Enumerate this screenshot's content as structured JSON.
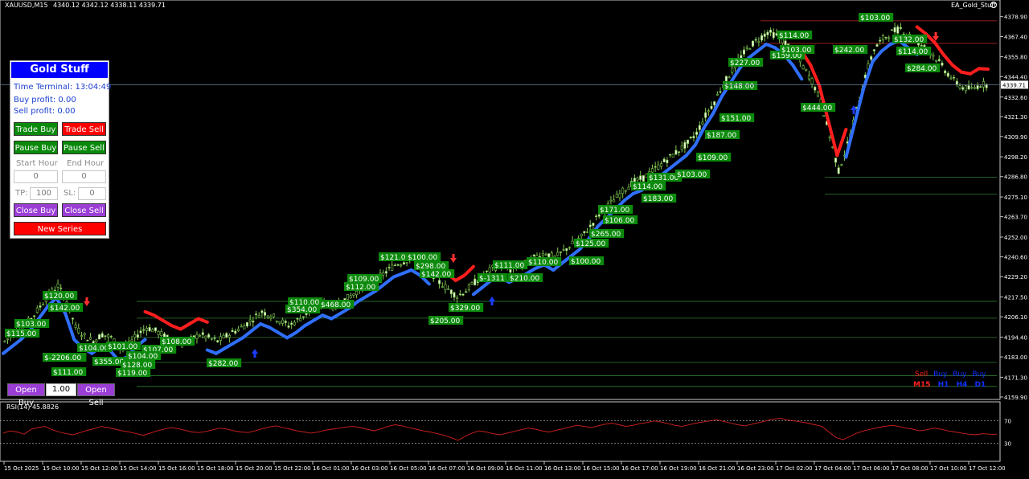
{
  "header": {
    "symbol": "XAUUSD,M15",
    "ohlc": "4340.12 4342.12 4338.11 4339.71",
    "ea_name": "EA_Gold_Stuff"
  },
  "panel": {
    "title": "Gold Stuff",
    "time_terminal": "Time Terminal: 13:04:49",
    "buy_profit": "Buy profit: 0.00",
    "sell_profit": "Sell profit: 0.00",
    "trade_buy": "Trade Buy",
    "trade_sell": "Trade Sell",
    "pause_buy": "Pause Buy",
    "pause_sell": "Pause Sell",
    "start_hour_label": "Start Hour",
    "end_hour_label": "End Hour",
    "start_hour_value": "0",
    "end_hour_value": "0",
    "tp_label": "TP:",
    "tp_value": "100",
    "sl_label": "SL:",
    "sl_value": "0",
    "close_buy": "Close Buy",
    "close_sell": "Close Sell",
    "new_series": "New Series"
  },
  "bottom": {
    "open_buy": "Open Buy",
    "lot": "1.00",
    "open_sell": "Open Sell"
  },
  "legend": {
    "row1": [
      "Sell",
      "Buy",
      "Buy",
      "Buy"
    ],
    "row2": [
      "M15",
      "H1",
      "H4",
      "D1"
    ]
  },
  "price_axis": {
    "ticks": [
      "4378.90",
      "4367.40",
      "4355.80",
      "4344.40",
      "4332.60",
      "4321.30",
      "4309.90",
      "4298.20",
      "4286.80",
      "4275.10",
      "4263.70",
      "4252.00",
      "4240.60",
      "4229.20",
      "4217.50",
      "4206.10",
      "4194.40",
      "4183.00",
      "4171.30",
      "4159.90"
    ],
    "current": "4339.71"
  },
  "time_axis": {
    "ticks": [
      "15 Oct 2025",
      "15 Oct 10:00",
      "15 Oct 12:00",
      "15 Oct 14:00",
      "15 Oct 16:00",
      "15 Oct 18:00",
      "15 Oct 20:00",
      "15 Oct 22:00",
      "16 Oct 01:00",
      "16 Oct 03:00",
      "16 Oct 05:00",
      "16 Oct 07:00",
      "16 Oct 09:00",
      "16 Oct 11:00",
      "16 Oct 13:00",
      "16 Oct 15:00",
      "16 Oct 17:00",
      "16 Oct 19:00",
      "16 Oct 21:00",
      "16 Oct 23:00",
      "17 Oct 02:00",
      "17 Oct 04:00",
      "17 Oct 06:00",
      "17 Oct 08:00",
      "17 Oct 10:00",
      "17 Oct 12:00"
    ]
  },
  "rsi": {
    "label": "RSI(14) 45.8826",
    "levels": [
      "100",
      "70",
      "30",
      "0"
    ],
    "values": [
      48,
      52,
      50,
      46,
      55,
      58,
      60,
      54,
      50,
      47,
      45,
      49,
      53,
      56,
      60,
      58,
      55,
      52,
      50,
      47,
      44,
      48,
      52,
      55,
      58,
      56,
      53,
      50,
      49,
      51,
      54,
      57,
      55,
      52,
      50,
      49,
      52,
      56,
      59,
      61,
      58,
      55,
      52,
      50,
      48,
      50,
      53,
      55,
      57,
      59,
      60,
      58,
      55,
      52,
      56,
      60,
      63,
      61,
      58,
      55,
      52,
      50,
      47,
      44,
      40,
      35,
      42,
      48,
      52,
      50,
      47,
      45,
      48,
      51,
      54,
      57,
      55,
      52,
      50,
      53,
      56,
      59,
      62,
      60,
      58,
      61,
      64,
      66,
      63,
      60,
      62,
      65,
      67,
      70,
      68,
      65,
      62,
      60,
      63,
      66,
      68,
      70,
      72,
      69,
      66,
      63,
      61,
      64,
      67,
      70,
      73,
      75,
      72,
      70,
      68,
      66,
      63,
      60,
      50,
      40,
      36,
      42,
      48,
      52,
      55,
      58,
      60,
      62,
      60,
      57,
      55,
      52,
      54,
      57,
      55,
      52,
      50,
      48,
      46,
      45,
      47,
      46,
      45.9
    ]
  },
  "chart_data": {
    "type": "candlestick",
    "y_range": [
      4159.9,
      4382.0
    ],
    "current_price": 4339.71,
    "price_path": [
      4192,
      4196,
      4200,
      4205,
      4212,
      4219,
      4224,
      4215,
      4200,
      4195,
      4192,
      4196,
      4194,
      4188,
      4190,
      4196,
      4200,
      4198,
      4195,
      4192,
      4190,
      4193,
      4196,
      4194,
      4192,
      4195,
      4198,
      4201,
      4205,
      4209,
      4207,
      4204,
      4201,
      4204,
      4208,
      4211,
      4214,
      4212,
      4215,
      4218,
      4222,
      4225,
      4228,
      4232,
      4236,
      4238,
      4240,
      4237,
      4232,
      4226,
      4222,
      4218,
      4221,
      4226,
      4230,
      4234,
      4236,
      4233,
      4235,
      4238,
      4241,
      4243,
      4240,
      4244,
      4248,
      4252,
      4258,
      4265,
      4270,
      4275,
      4280,
      4284,
      4286,
      4290,
      4294,
      4298,
      4302,
      4306,
      4312,
      4322,
      4330,
      4340,
      4348,
      4356,
      4362,
      4366,
      4370,
      4368,
      4364,
      4358,
      4350,
      4342,
      4330,
      4310,
      4290,
      4305,
      4325,
      4345,
      4360,
      4366,
      4370,
      4372,
      4368,
      4364,
      4360,
      4355,
      4348,
      4342,
      4338,
      4337,
      4340,
      4339.7
    ],
    "supertrend_buy_color": "#2f6fff",
    "supertrend_sell_color": "#ff1e1e",
    "profit_labels": [
      {
        "t": "$115.00",
        "x": 6,
        "y": 409
      },
      {
        "t": "$103.00",
        "x": 18,
        "y": 397
      },
      {
        "t": "$142.00",
        "x": 60,
        "y": 377
      },
      {
        "t": "$120.00",
        "x": 53,
        "y": 362
      },
      {
        "t": "$-2206.00",
        "x": 53,
        "y": 439
      },
      {
        "t": "$111.00",
        "x": 64,
        "y": 457
      },
      {
        "t": "$104.00",
        "x": 96,
        "y": 427
      },
      {
        "t": "$355.00",
        "x": 115,
        "y": 444
      },
      {
        "t": "$101.00",
        "x": 132,
        "y": 425
      },
      {
        "t": "$107.00",
        "x": 176,
        "y": 429
      },
      {
        "t": "$104.00",
        "x": 157,
        "y": 437
      },
      {
        "t": "$128.00",
        "x": 150,
        "y": 448
      },
      {
        "t": "$119.00",
        "x": 144,
        "y": 458
      },
      {
        "t": "$108.00",
        "x": 199,
        "y": 419
      },
      {
        "t": "$282.00",
        "x": 257,
        "y": 446
      },
      {
        "t": "$110.00",
        "x": 358,
        "y": 370
      },
      {
        "t": "$354.00",
        "x": 355,
        "y": 379
      },
      {
        "t": "$468.00",
        "x": 397,
        "y": 373
      },
      {
        "t": "$109.00",
        "x": 432,
        "y": 341
      },
      {
        "t": "$112.00",
        "x": 428,
        "y": 351
      },
      {
        "t": "$121.00",
        "x": 471,
        "y": 314
      },
      {
        "t": "$100.00",
        "x": 505,
        "y": 314
      },
      {
        "t": "$298.00",
        "x": 515,
        "y": 325
      },
      {
        "t": "$142.00",
        "x": 522,
        "y": 335
      },
      {
        "t": "$329.00",
        "x": 558,
        "y": 377
      },
      {
        "t": "$205.00",
        "x": 533,
        "y": 393
      },
      {
        "t": "$-1311",
        "x": 594,
        "y": 340
      },
      {
        "t": "$210.00",
        "x": 632,
        "y": 340
      },
      {
        "t": "$111.00",
        "x": 613,
        "y": 324
      },
      {
        "t": "$110.00",
        "x": 655,
        "y": 320
      },
      {
        "t": "$100.00",
        "x": 708,
        "y": 319
      },
      {
        "t": "$125.00",
        "x": 714,
        "y": 297
      },
      {
        "t": "$265.00",
        "x": 733,
        "y": 285
      },
      {
        "t": "$106.00",
        "x": 750,
        "y": 268
      },
      {
        "t": "$171.00",
        "x": 744,
        "y": 255
      },
      {
        "t": "$183.00",
        "x": 798,
        "y": 241
      },
      {
        "t": "$114.00",
        "x": 785,
        "y": 226
      },
      {
        "t": "$131.00",
        "x": 805,
        "y": 215
      },
      {
        "t": "$103.00",
        "x": 840,
        "y": 211
      },
      {
        "t": "$109.00",
        "x": 866,
        "y": 190
      },
      {
        "t": "$187.00",
        "x": 877,
        "y": 162
      },
      {
        "t": "$151.00",
        "x": 895,
        "y": 141
      },
      {
        "t": "$148.00",
        "x": 899,
        "y": 101
      },
      {
        "t": "$227.00",
        "x": 906,
        "y": 72
      },
      {
        "t": "$159.00",
        "x": 958,
        "y": 63
      },
      {
        "t": "$103.00",
        "x": 970,
        "y": 56
      },
      {
        "t": "$114.00",
        "x": 967,
        "y": 38
      },
      {
        "t": "$444.00",
        "x": 996,
        "y": 128
      },
      {
        "t": "$242.00",
        "x": 1036,
        "y": 56
      },
      {
        "t": "$132.00",
        "x": 1110,
        "y": 43
      },
      {
        "t": "$114.00",
        "x": 1115,
        "y": 58
      },
      {
        "t": "$284.00",
        "x": 1126,
        "y": 79
      },
      {
        "t": "$103.00",
        "x": 1068,
        "y": 16
      }
    ],
    "arrows_up": [
      {
        "x": 317,
        "y": 440
      },
      {
        "x": 612,
        "y": 375
      },
      {
        "x": 1062,
        "y": 137
      }
    ],
    "arrows_down": [
      {
        "x": 108,
        "y": 375
      },
      {
        "x": 564,
        "y": 321
      },
      {
        "x": 1164,
        "y": 45
      }
    ]
  }
}
